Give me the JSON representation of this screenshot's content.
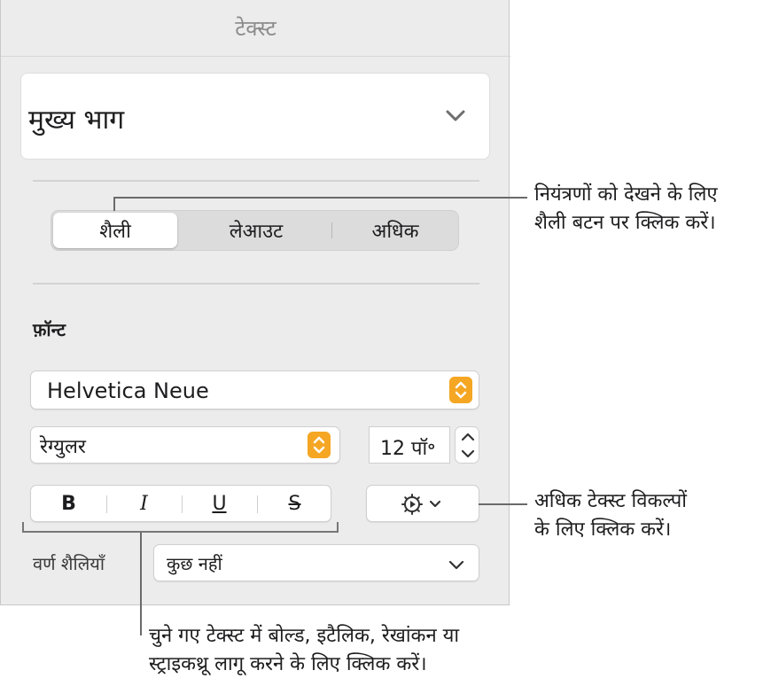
{
  "panel": {
    "title": "टेक्स्ट",
    "paragraph_style": "मुख्य भाग",
    "tabs": [
      "शैली",
      "लेआउट",
      "अधिक"
    ],
    "font_heading": "फ़ॉन्ट",
    "font_family": "Helvetica Neue",
    "typeface": "रेग्युलर",
    "font_size": "12 पॉ॰",
    "style_buttons": [
      "B",
      "I",
      "U",
      "S"
    ],
    "character_styles_label": "वर्ण शैलियाँ",
    "character_style_value": "कुछ नहीं"
  },
  "callouts": {
    "tabs": [
      "नियंत्रणों को देखने के लिए",
      "शैली बटन पर क्लिक करें।"
    ],
    "gear": [
      "अधिक टेक्स्ट विकल्पों",
      "के लिए क्लिक करें।"
    ],
    "style_buttons": [
      "चुने गए टेक्स्ट में बोल्ड, इटैलिक, रेखांकन या",
      "स्ट्राइकथ्रू लागू करने के लिए क्लिक करें।"
    ]
  },
  "colors": {
    "accent_popup_arrows": "#f5a623",
    "panel_background": "#ececec"
  }
}
